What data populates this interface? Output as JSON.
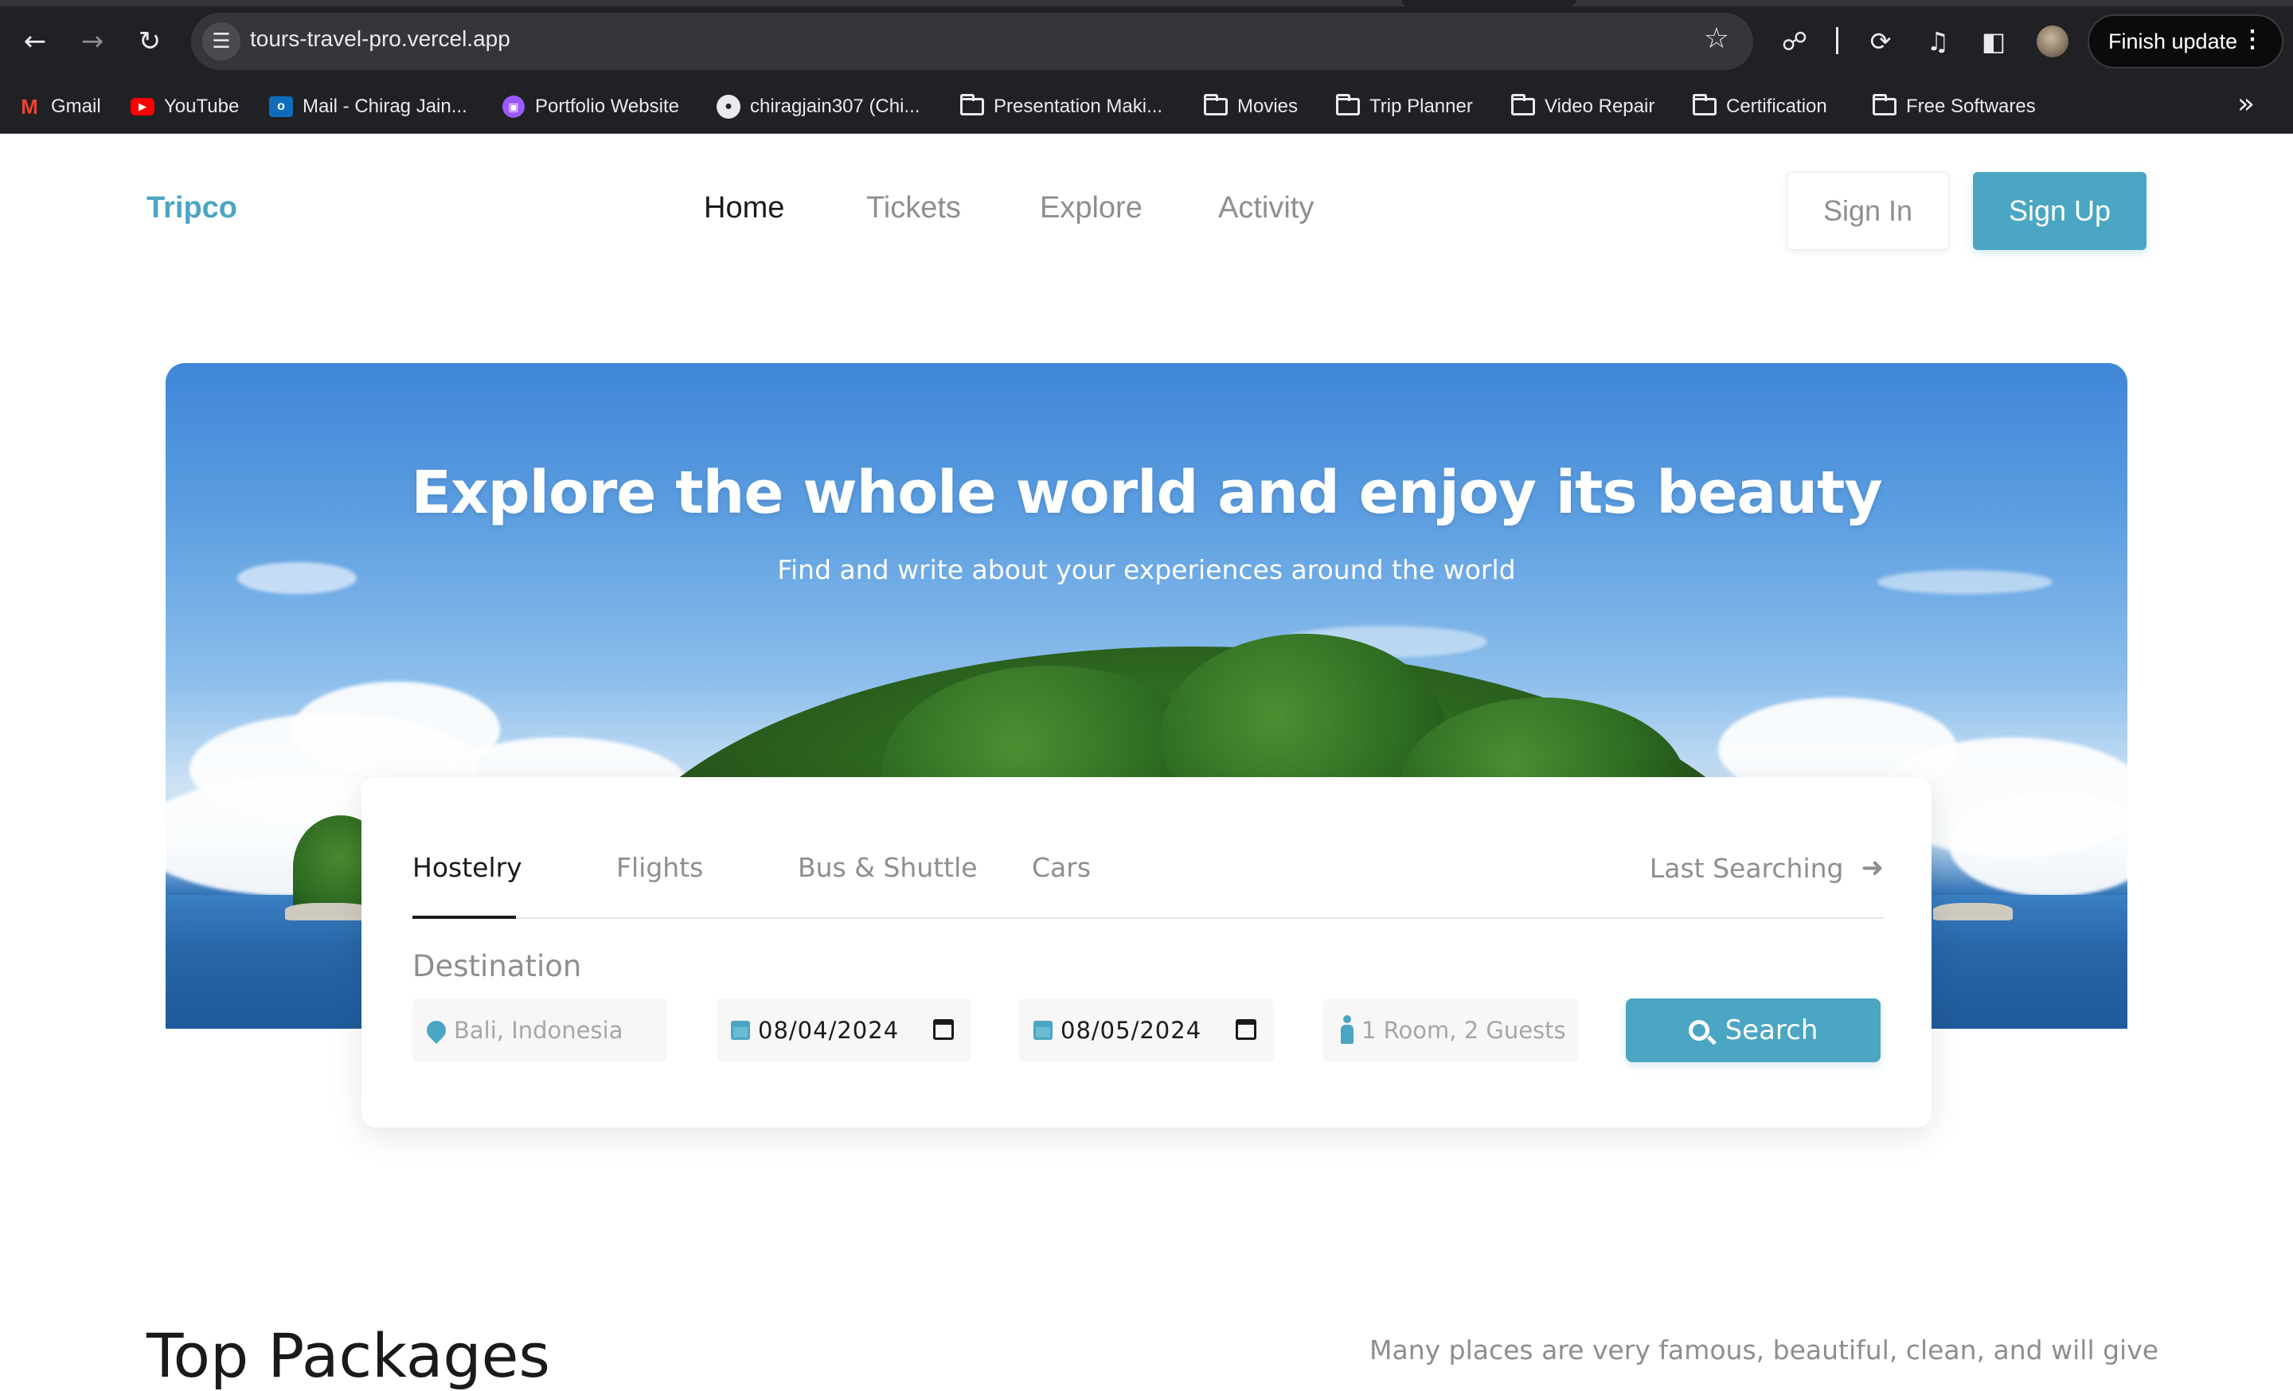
{
  "browser": {
    "url": "tours-travel-pro.vercel.app",
    "finish_update_label": "Finish update",
    "bookmarks": [
      {
        "label": "Gmail",
        "icon": "gmail-icon"
      },
      {
        "label": "YouTube",
        "icon": "youtube-icon"
      },
      {
        "label": "Mail - Chirag Jain...",
        "icon": "outlook-icon"
      },
      {
        "label": "Portfolio Website",
        "icon": "portfolio-icon"
      },
      {
        "label": "chiragjain307 (Chi...",
        "icon": "github-icon"
      },
      {
        "label": "Presentation Maki...",
        "icon": "folder-icon"
      },
      {
        "label": "Movies",
        "icon": "folder-icon"
      },
      {
        "label": "Trip Planner",
        "icon": "folder-icon"
      },
      {
        "label": "Video Repair",
        "icon": "folder-icon"
      },
      {
        "label": "Certification",
        "icon": "folder-icon"
      },
      {
        "label": "Free Softwares",
        "icon": "folder-icon"
      }
    ]
  },
  "header": {
    "logo": "Tripco",
    "nav": [
      {
        "label": "Home",
        "active": true
      },
      {
        "label": "Tickets",
        "active": false
      },
      {
        "label": "Explore",
        "active": false
      },
      {
        "label": "Activity",
        "active": false
      }
    ],
    "signin_label": "Sign In",
    "signup_label": "Sign Up"
  },
  "hero": {
    "title": "Explore the whole world and enjoy its beauty",
    "subtitle": "Find and write about your experiences around the world"
  },
  "search": {
    "tabs": [
      {
        "label": "Hostelry",
        "active": true
      },
      {
        "label": "Flights",
        "active": false
      },
      {
        "label": "Bus & Shuttle",
        "active": false
      },
      {
        "label": "Cars",
        "active": false
      }
    ],
    "last_searching_label": "Last Searching",
    "destination_label": "Destination",
    "destination_placeholder": "Bali, Indonesia",
    "checkin_date": "08/04/2024",
    "checkout_date": "08/05/2024",
    "guests_placeholder": "1 Room, 2 Guests",
    "search_button_label": "Search"
  },
  "packages": {
    "title": "Top Packages",
    "description": "Many places are very famous, beautiful, clean, and will give"
  },
  "colors": {
    "accent": "#4aa6c2",
    "text_dark": "#1a1a1a",
    "text_muted": "#8e8e8e"
  }
}
